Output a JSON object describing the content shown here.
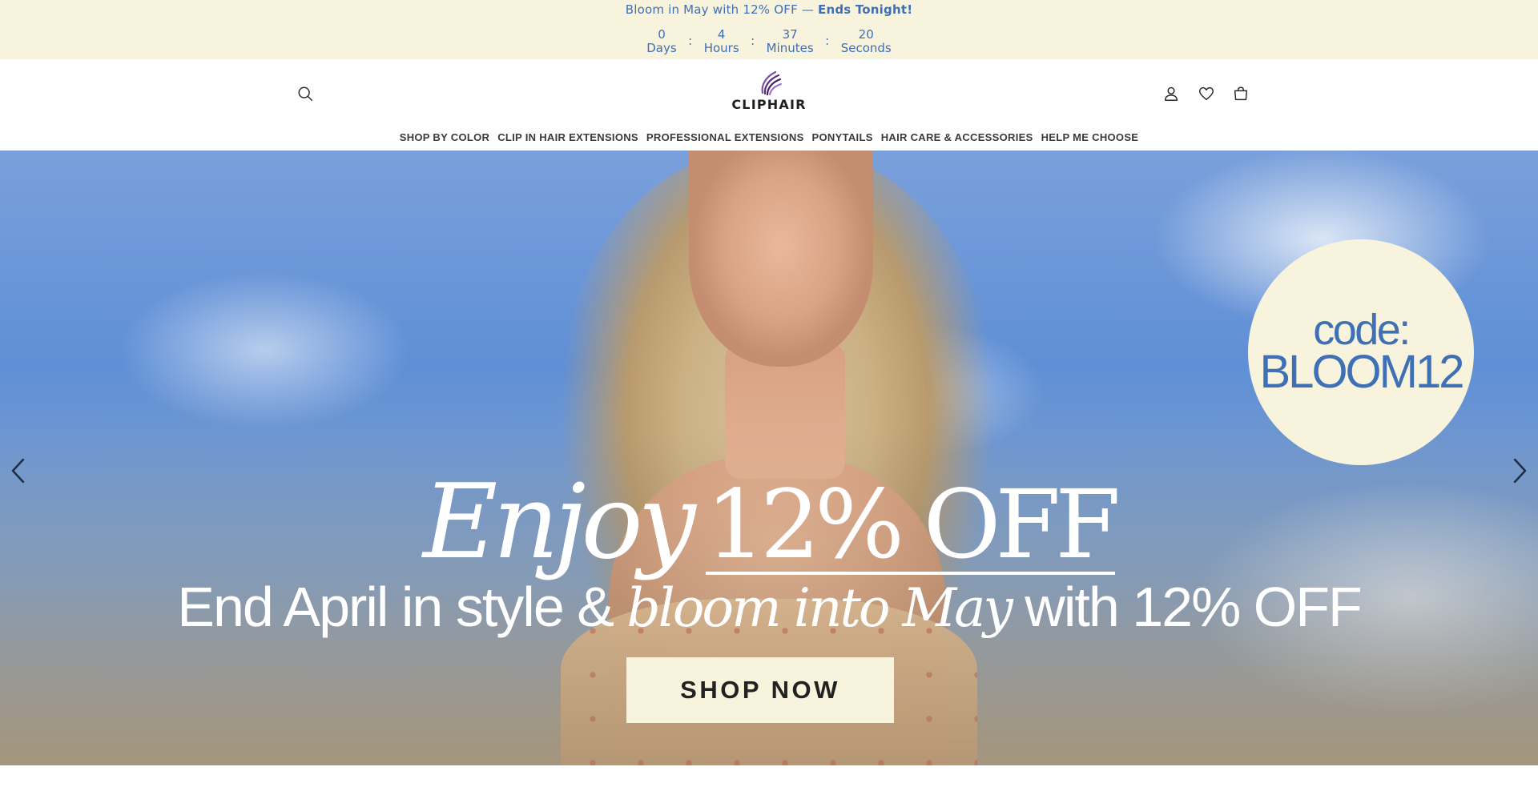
{
  "announcement": {
    "text": "Bloom in May with 12% OFF —",
    "emphasis": "Ends Tonight!",
    "countdown": [
      {
        "value": "0",
        "label": "Days"
      },
      {
        "value": "4",
        "label": "Hours"
      },
      {
        "value": "37",
        "label": "Minutes"
      },
      {
        "value": "20",
        "label": "Seconds"
      }
    ],
    "separator": ":"
  },
  "header": {
    "logo_text": "CLIPHAIR",
    "icons": [
      "search-icon",
      "account-icon",
      "wishlist-icon",
      "cart-icon"
    ],
    "nav": [
      "SHOP BY COLOR",
      "CLIP IN HAIR EXTENSIONS",
      "PROFESSIONAL EXTENSIONS",
      "PONYTAILS",
      "HAIR CARE & ACCESSORIES",
      "HELP ME CHOOSE"
    ]
  },
  "hero": {
    "promo_code_label": "code:",
    "promo_code": "BLOOM12",
    "headline_italic": "Enjoy",
    "headline_offer": "12% OFF",
    "sub_part1": "End April in style &",
    "sub_italic": "bloom into May",
    "sub_part2": "with",
    "sub_part3": "12% OFF",
    "cta_label": "SHOP NOW",
    "arrows": [
      "chevron-left-icon",
      "chevron-right-icon"
    ]
  },
  "colors": {
    "announcement_bg": "#f8f3dc",
    "accent_blue": "#3f6fb4",
    "cta_bg": "#f8f3dc",
    "logo_purple": "#5a2d82"
  }
}
